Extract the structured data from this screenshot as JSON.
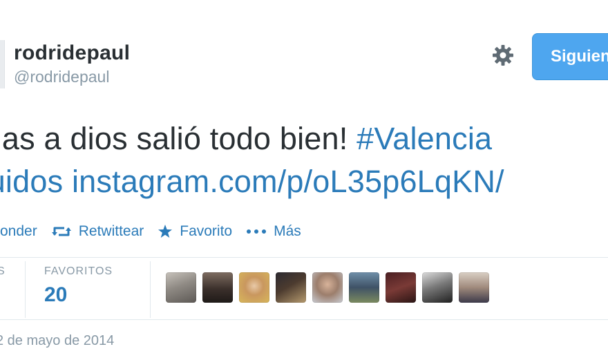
{
  "user": {
    "display_name": "rodridepaul",
    "handle": "@rodridepaul"
  },
  "follow_label": "Siguien",
  "tweet": {
    "line1_text": "cias a dios salió todo bien! ",
    "line1_hashtag": "#Valencia",
    "line2_prefix": "tuidos ",
    "line2_link": "instagram.com/p/oL35p6LqKN/"
  },
  "actions": {
    "reply": "onder",
    "retweet": "Retwittear",
    "favorite": "Favorito",
    "more": "Más"
  },
  "stats": {
    "left_partial_label": "S",
    "favorites_label": "FAVORITOS",
    "favorites_count": "20"
  },
  "favoriters_count": 9,
  "date": "2 de mayo de 2014",
  "colors": {
    "link": "#2b7bb9",
    "follow_button": "#4ea6ef",
    "muted": "#8899a6",
    "text": "#292f33"
  },
  "icons": [
    "gear-icon",
    "retweet-icon",
    "star-icon",
    "more-dots-icon"
  ]
}
